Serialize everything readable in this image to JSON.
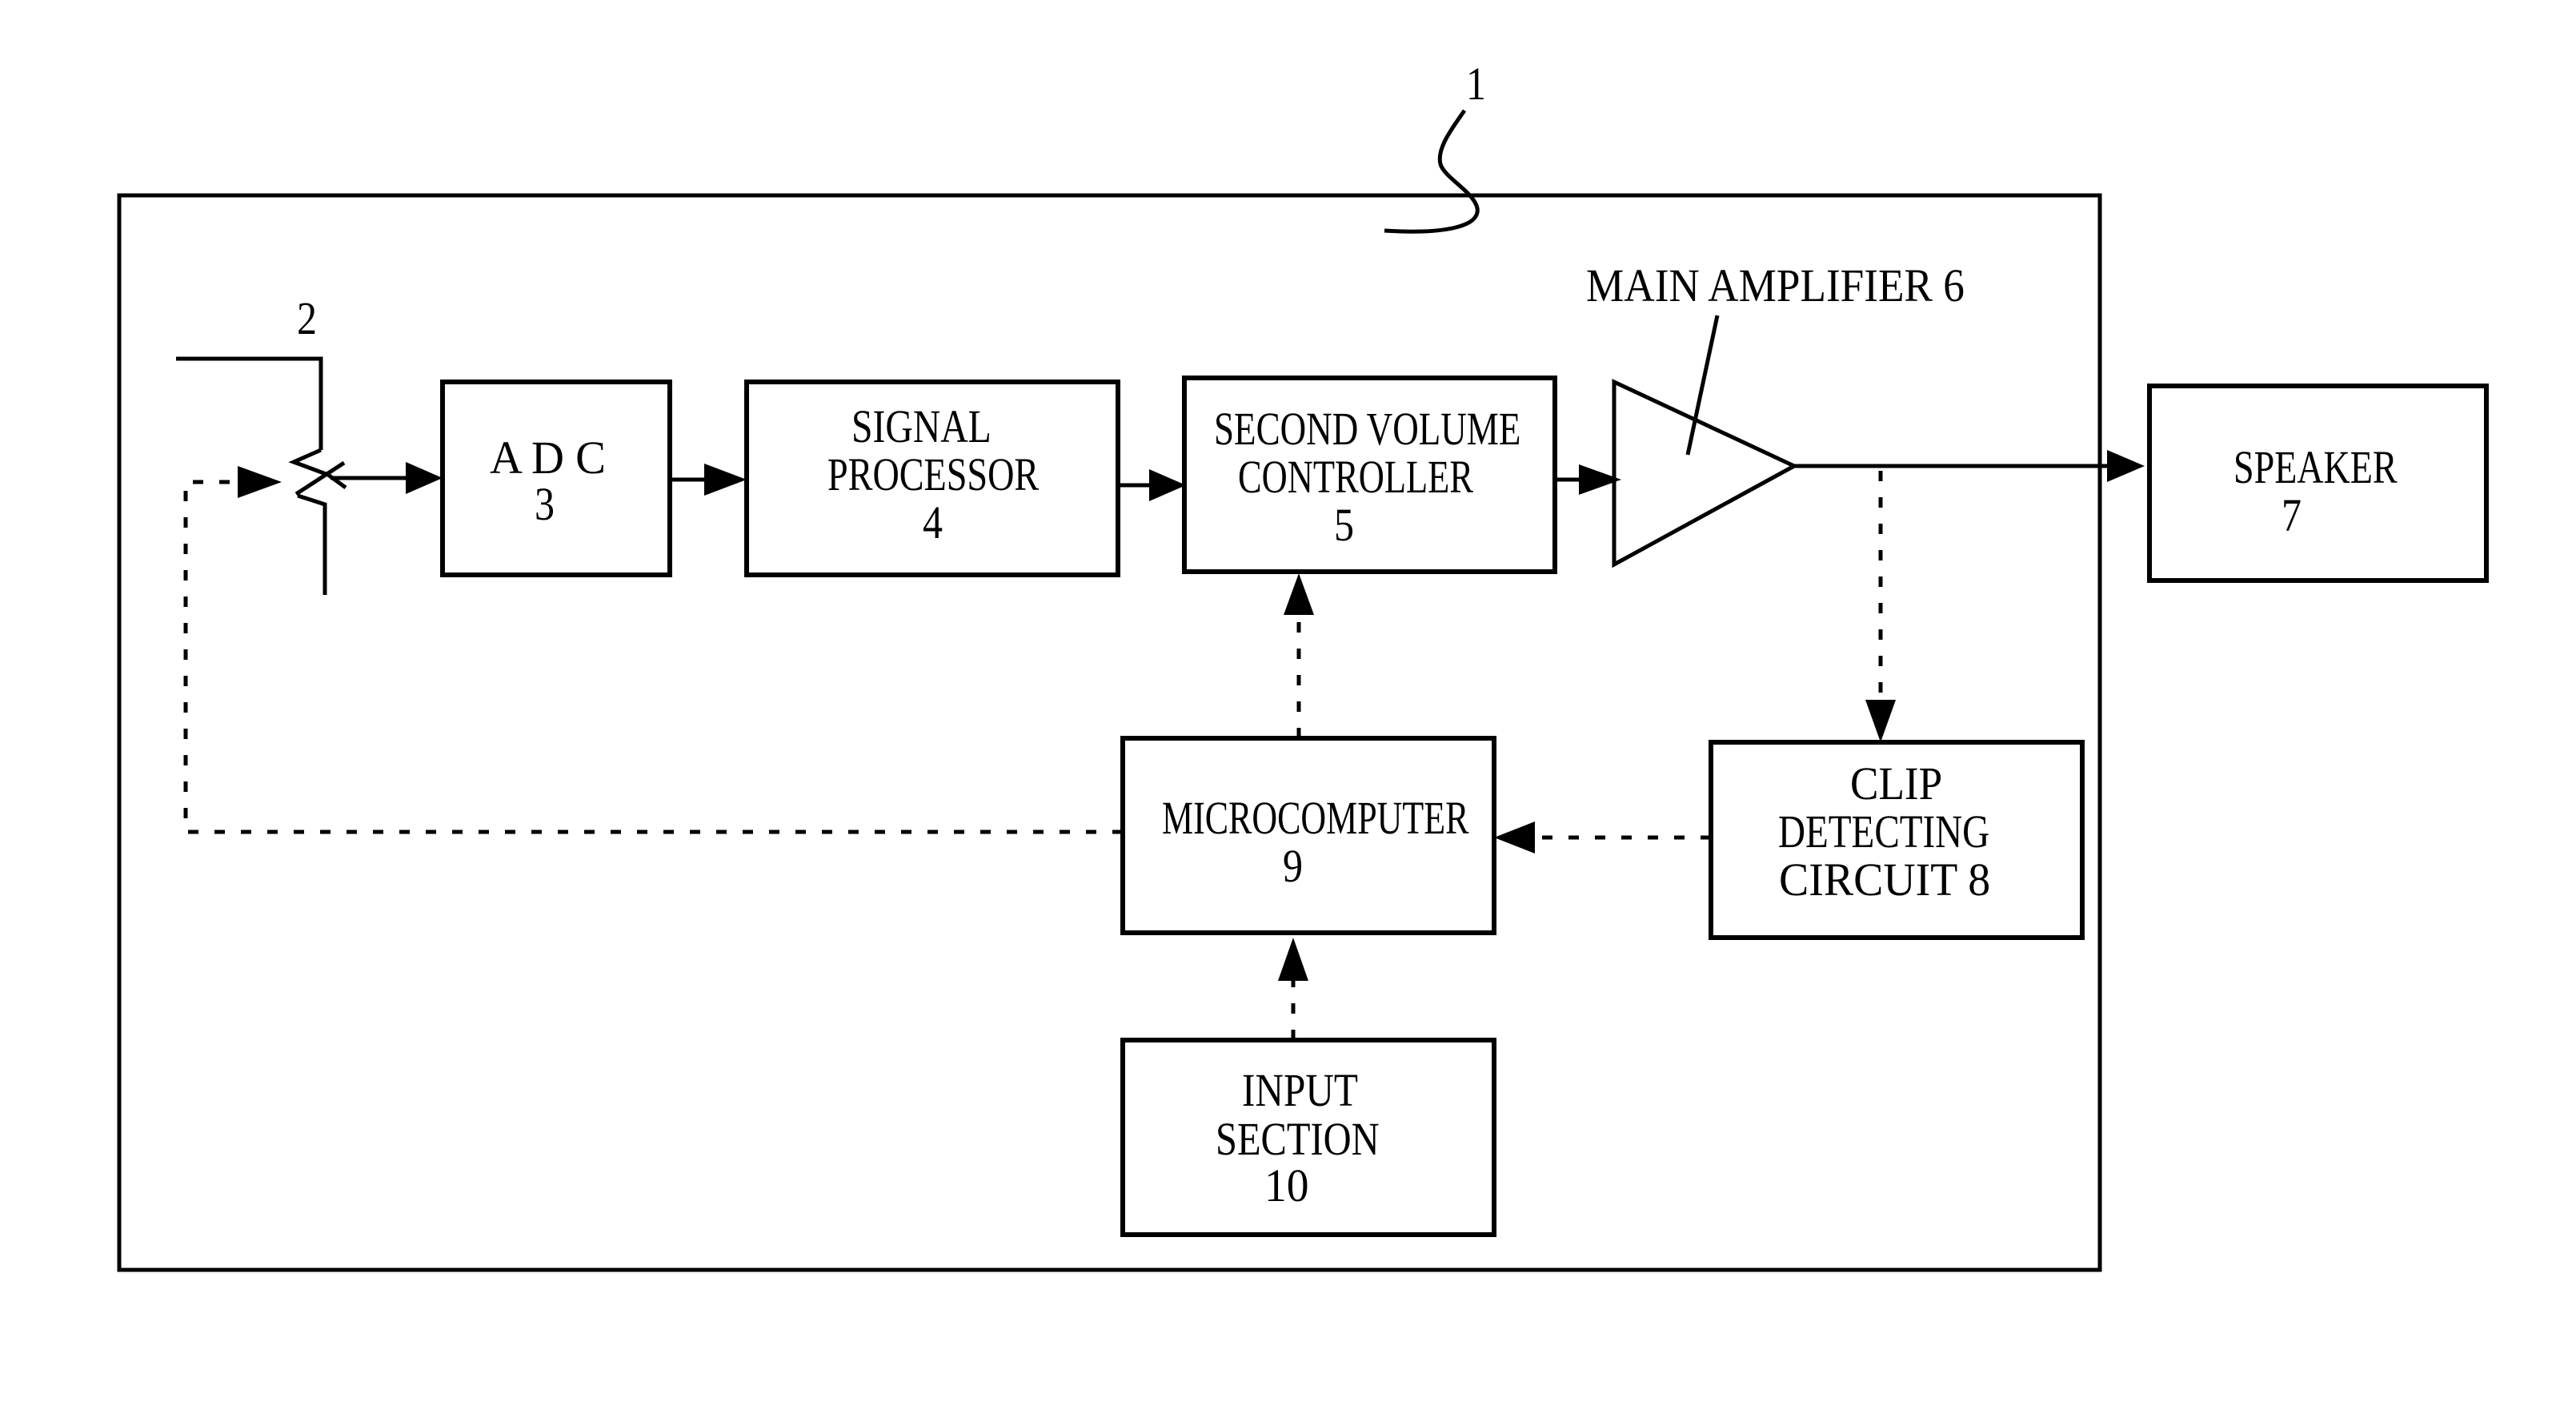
{
  "figure": {
    "reference_label": "1",
    "colors": {
      "ink": "#000000",
      "background": "#ffffff"
    }
  },
  "components": {
    "volume": {
      "ref": "2"
    },
    "adc": {
      "lines": [
        "A D C",
        "3"
      ]
    },
    "signal_processor": {
      "lines": [
        "SIGNAL",
        "PROCESSOR",
        "4"
      ]
    },
    "second_volume_controller": {
      "lines": [
        "SECOND VOLUME",
        "CONTROLLER",
        "5"
      ]
    },
    "main_amplifier": {
      "label": "MAIN AMPLIFIER 6"
    },
    "speaker": {
      "lines": [
        "SPEAKER",
        "7"
      ]
    },
    "clip_detecting_circuit": {
      "lines": [
        "CLIP",
        "DETECTING",
        "CIRCUIT 8"
      ]
    },
    "microcomputer": {
      "lines": [
        "MICROCOMPUTER",
        "9"
      ]
    },
    "input_section": {
      "lines": [
        "INPUT",
        "SECTION",
        "10"
      ]
    }
  },
  "connections": [
    {
      "from": "volume 2",
      "to": "ADC 3",
      "style": "solid"
    },
    {
      "from": "ADC 3",
      "to": "signal processor 4",
      "style": "solid"
    },
    {
      "from": "signal processor 4",
      "to": "second volume controller 5",
      "style": "solid"
    },
    {
      "from": "second volume controller 5",
      "to": "main amplifier 6",
      "style": "solid"
    },
    {
      "from": "main amplifier 6",
      "to": "speaker 7",
      "style": "solid"
    },
    {
      "from": "main amplifier 6",
      "to": "clip detecting circuit 8",
      "style": "dashed"
    },
    {
      "from": "clip detecting circuit 8",
      "to": "microcomputer 9",
      "style": "dashed"
    },
    {
      "from": "microcomputer 9",
      "to": "second volume controller 5",
      "style": "dashed"
    },
    {
      "from": "microcomputer 9",
      "to": "volume 2",
      "style": "dashed"
    },
    {
      "from": "input section 10",
      "to": "microcomputer 9",
      "style": "dashed"
    }
  ]
}
